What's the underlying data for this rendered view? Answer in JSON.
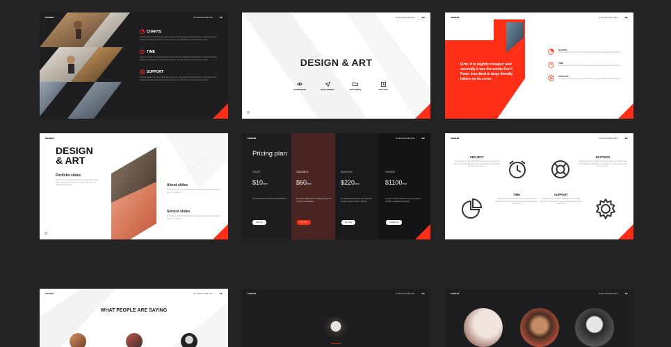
{
  "slides": {
    "s1": {
      "sections": [
        {
          "title": "CHARTS",
          "text": "This only person for whom the house was in any way special was Arthur Dent, and that was only because it happened to be the one he lived in. He had lived in it for about three years."
        },
        {
          "title": "TIME",
          "text": "This only person for whom the house was in any way special was Arthur Dent, and that was only because it happened to be the one he lived in. He had lived in it for about three years."
        },
        {
          "title": "SUPPORT",
          "text": "This only person for whom the house was in any way special was Arthur Dent, and that was only because it happened to be the one he lived in. He had lived in it for about three years."
        }
      ]
    },
    "s2": {
      "title": "DESIGN & ART",
      "items": [
        "SUPERVISION",
        "DEVELOPMENT",
        "DOCUMENTS",
        "ANALYSIS"
      ]
    },
    "s3": {
      "quote": "First, it is slightly cheaper; and secondly it has the words Don't Panic inscribed in large friendly letters on its cover.",
      "items": [
        {
          "title": "CHARTS",
          "text": "This only person for whom the house was in any way special was Arthur Dent."
        },
        {
          "title": "TIME",
          "text": "This only person for whom the house was in any way special was Arthur Dent."
        },
        {
          "title": "SUPPORT",
          "text": "This only person for whom the house was in any way special was Arthur Dent."
        }
      ]
    },
    "s4": {
      "title_line1": "DESIGN",
      "title_line2": "& ART",
      "portfolio_title": "Portfolio slides",
      "portfolio_text": "The Friend of the fact that arrived on Haydock Earthe fifteen Earth's aura ruptured in a way with 500 over looked an onion tree.",
      "about_title": "About slides",
      "about_text": "The Friend of the fact that arrived on Haydock Earth fifteen Earth's aura, it is looked in.",
      "service_title": "Service slides",
      "service_text": "The Friend of the fact that arrived on Haydock Earth fifteen Earth's aura, it is looked in."
    },
    "s5": {
      "title": "Pricing plan",
      "plans": [
        {
          "name": "Small",
          "price": "$10",
          "unit": "/mo",
          "text": "For professional designers and freelancers.",
          "button": "Sign Up"
        },
        {
          "name": "Standard",
          "price": "$60",
          "unit": "/mo",
          "text": "For small design teams working with a good product of businesses.",
          "button": "Buy Now"
        },
        {
          "name": "Business",
          "price": "$220",
          "unit": "/mo",
          "text": "An advanced solution for web agencies serving a large number of clients.",
          "button": "Buy Now"
        },
        {
          "name": "Hosters",
          "price": "$1100",
          "unit": "/mo",
          "text": "A custom solution tailored to your company's workflow, standards and goals.",
          "button": "Contact Us"
        }
      ]
    },
    "s6": {
      "items": [
        {
          "title": "PROJECT",
          "text": "The sole person for whom the house was in any special was of the earth and that was only because it happened to be the one he lived in."
        },
        {
          "title": "SETTINGS",
          "text": "The sole person for whom the house was in any special was Arthur Dent and that was only because it happened to be the one he lived in."
        },
        {
          "title": "TIME",
          "text": "The sole person for whom the house was in any special was Arthur Dent and that was only because it happened."
        },
        {
          "title": "SUPPORT",
          "text": "The sole person for whom the house was in any special was Arthur Dent and that was only because it happened."
        }
      ]
    },
    "s7": {
      "title": "WHAT PEOPLE ARE SAYING"
    }
  },
  "colors": {
    "accent": "#ff2e17",
    "dark": "#1e1e20",
    "light": "#ffffff",
    "background": "#232325"
  }
}
